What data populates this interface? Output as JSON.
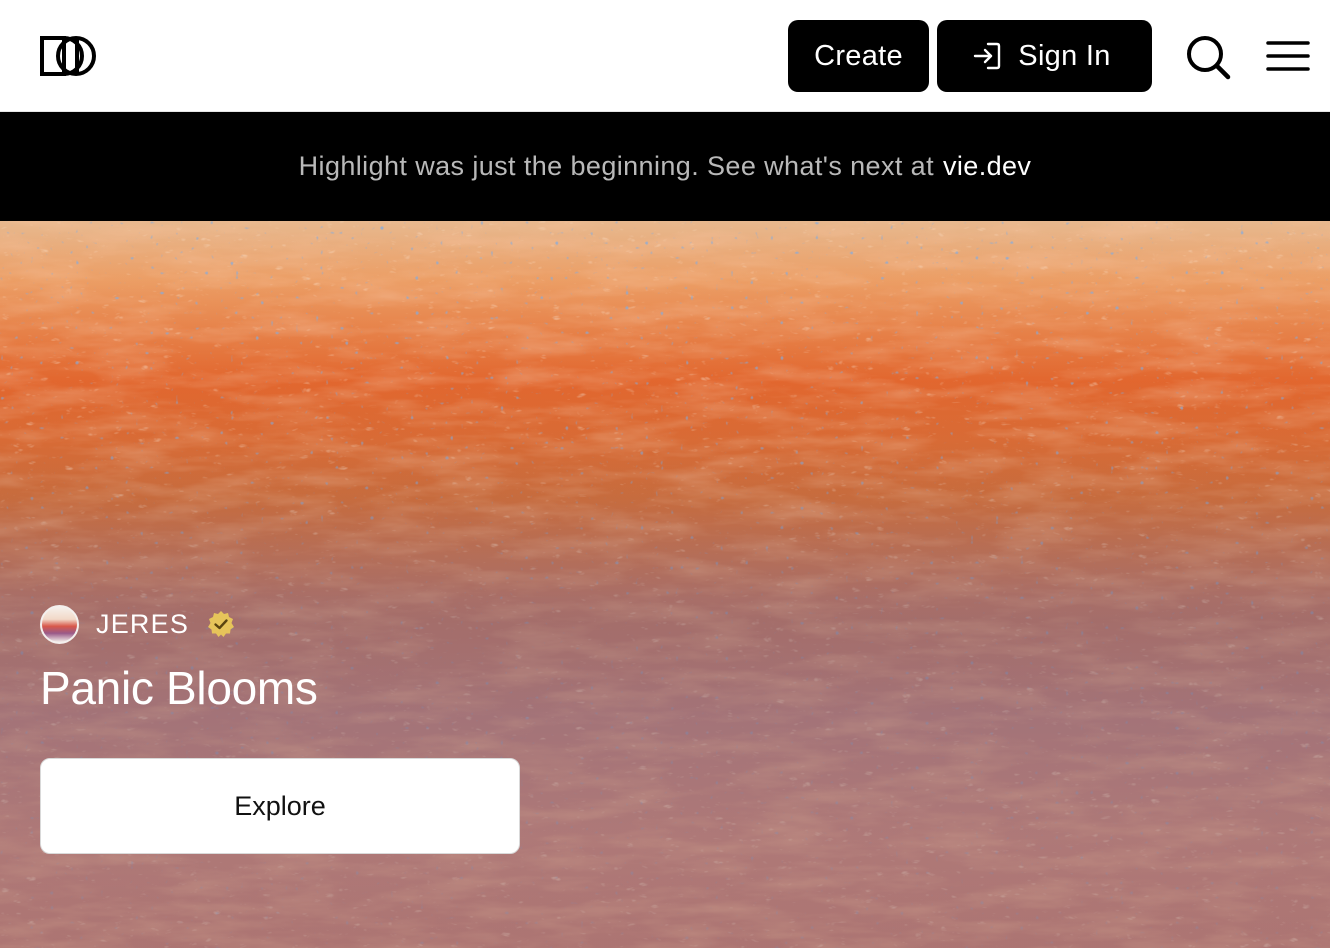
{
  "header": {
    "logo_icon": "brand-logo-icon",
    "create_label": "Create",
    "signin_label": "Sign In",
    "signin_icon": "sign-in-arrow-icon",
    "search_icon": "search-icon",
    "menu_icon": "hamburger-menu-icon"
  },
  "banner": {
    "text": "Highlight was just the beginning. See what's next at",
    "link": "vie.dev"
  },
  "hero": {
    "artist": "JERES",
    "verified_icon": "verified-badge-icon",
    "title": "Panic Blooms",
    "explore_label": "Explore"
  },
  "colors": {
    "brand_dark": "#000000",
    "banner_text": "#b9b9b9",
    "verified_gold": "#e6c45a",
    "art_orange": "#e8622a",
    "art_pink": "#c98a8a"
  }
}
